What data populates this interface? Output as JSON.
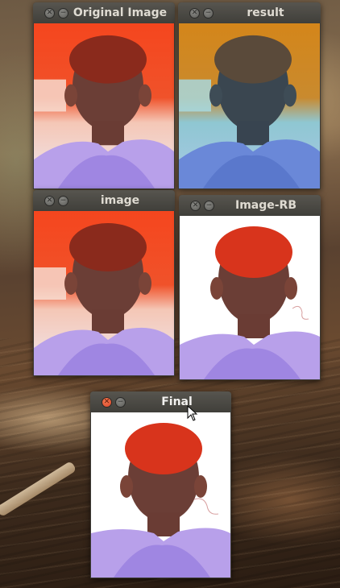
{
  "windows": {
    "original": {
      "title": "Original Image"
    },
    "result": {
      "title": "result"
    },
    "image": {
      "title": "image"
    },
    "image_rb": {
      "title": "Image-RB"
    },
    "final": {
      "title": "Final"
    }
  },
  "icons": {
    "close": "close-x-icon",
    "minimize": "minimize-dash-icon",
    "cursor": "mouse-pointer-icon"
  },
  "colors": {
    "titlebar": "#403f3a",
    "close_active": "#d9442a",
    "photo_red": "#f5461e",
    "photo_orange": "#d4861a",
    "masked_bg": "#ffffff",
    "shirt": "#a78ee6"
  }
}
